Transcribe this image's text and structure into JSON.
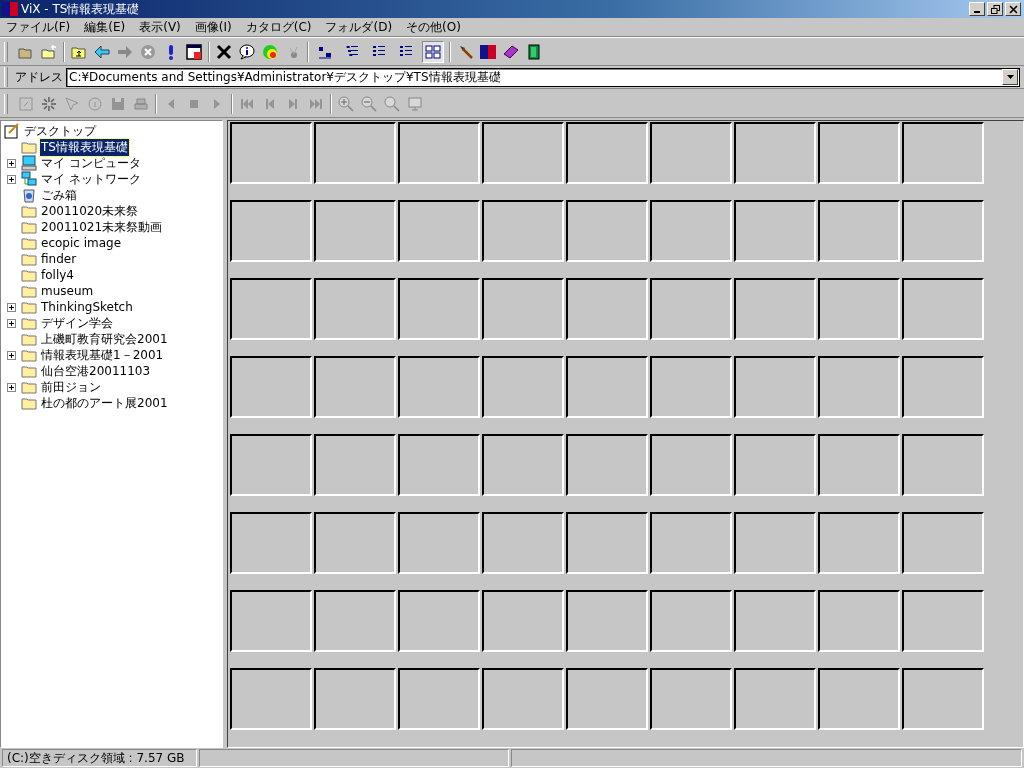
{
  "window": {
    "title": "ViX - TS情報表現基礎"
  },
  "menu": [
    "ファイル(F)",
    "編集(E)",
    "表示(V)",
    "画像(I)",
    "カタログ(C)",
    "フォルダ(D)",
    "その他(O)"
  ],
  "view_buttons": [
    {
      "selected": false
    },
    {
      "selected": false
    },
    {
      "selected": false
    },
    {
      "selected": false
    },
    {
      "selected": true
    }
  ],
  "address": {
    "label": "アドレス",
    "value": "C:¥Documents and Settings¥Administrator¥デスクトップ¥TS情報表現基礎"
  },
  "tree": {
    "label": "デスクトップ",
    "children": [
      {
        "label": "TS情報表現基礎",
        "kind": "folder",
        "expandable": false,
        "selected": true
      },
      {
        "label": "マイ コンピュータ",
        "kind": "computer",
        "expandable": true,
        "selected": false
      },
      {
        "label": "マイ ネットワーク",
        "kind": "network",
        "expandable": true,
        "selected": false
      },
      {
        "label": "ごみ箱",
        "kind": "trash",
        "expandable": false,
        "selected": false
      },
      {
        "label": "20011020未来祭",
        "kind": "folder",
        "expandable": false,
        "selected": false
      },
      {
        "label": "20011021未来祭動画",
        "kind": "folder",
        "expandable": false,
        "selected": false
      },
      {
        "label": "ecopic image",
        "kind": "folder",
        "expandable": false,
        "selected": false
      },
      {
        "label": "finder",
        "kind": "folder",
        "expandable": false,
        "selected": false
      },
      {
        "label": "folly4",
        "kind": "folder",
        "expandable": false,
        "selected": false
      },
      {
        "label": "museum",
        "kind": "folder",
        "expandable": false,
        "selected": false
      },
      {
        "label": "ThinkingSketch",
        "kind": "folder",
        "expandable": true,
        "selected": false
      },
      {
        "label": "デザイン学会",
        "kind": "folder",
        "expandable": true,
        "selected": false
      },
      {
        "label": "上磯町教育研究会2001",
        "kind": "folder",
        "expandable": false,
        "selected": false
      },
      {
        "label": "情報表現基礎1－2001",
        "kind": "folder",
        "expandable": true,
        "selected": false
      },
      {
        "label": "仙台空港20011103",
        "kind": "folder",
        "expandable": false,
        "selected": false
      },
      {
        "label": "前田ジョン",
        "kind": "folder",
        "expandable": true,
        "selected": false
      },
      {
        "label": "杜の都のアート展2001",
        "kind": "folder",
        "expandable": false,
        "selected": false
      }
    ]
  },
  "status_bar": [
    "(C:)空きディスク領域 : 7.57 GB"
  ]
}
